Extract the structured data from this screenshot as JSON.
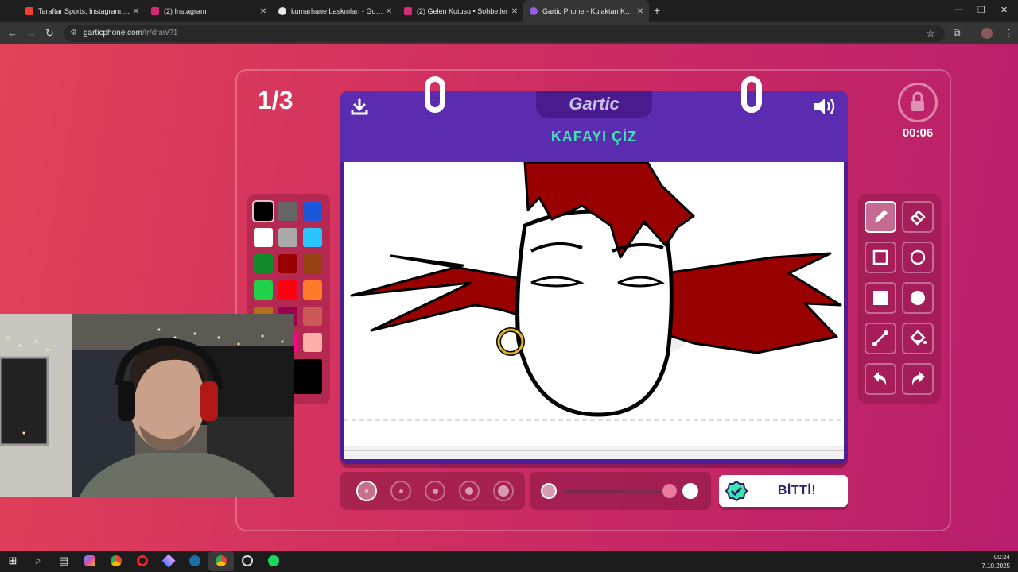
{
  "browser": {
    "tabs": [
      {
        "title": "Taraftar Sports, Instagram: \"\"Bu",
        "favicon": "gmail-icon",
        "color": "#ea4335"
      },
      {
        "title": "(2) Instagram",
        "favicon": "instagram-icon",
        "color": "#d62976"
      },
      {
        "title": "kumarhane baskınları - Google",
        "favicon": "google-icon",
        "color": "#4285f4"
      },
      {
        "title": "(2) Gelen Kutusu • Sohbetler",
        "favicon": "instagram-icon",
        "color": "#d62976"
      },
      {
        "title": "Gartic Phone - Kulaktan Kulağa",
        "favicon": "gartic-icon",
        "color": "#9b5de5"
      }
    ],
    "url_host": "garticphone.com",
    "url_path": "/tr/draw?1"
  },
  "game": {
    "round": "1/3",
    "timer": "00:06",
    "logo": "Gartic",
    "prompt": "KAFAYI ÇİZ",
    "done_label": "BİTTİ!",
    "palette": [
      "#000000",
      "#666666",
      "#1a56d8",
      "#ffffff",
      "#aaaaaa",
      "#29c5ff",
      "#118b2a",
      "#990000",
      "#964112",
      "#22d24a",
      "#ff0013",
      "#ff7b29",
      "#b0701c",
      "#99004e",
      "#cb5a57",
      "#ff5c9e",
      "#ff008f",
      "#feafa8"
    ],
    "selected_color": "#000000",
    "tools": [
      "pencil-icon",
      "eraser-icon",
      "rectangle-outline-icon",
      "ellipse-outline-icon",
      "rectangle-fill-icon",
      "ellipse-fill-icon",
      "line-icon",
      "fill-bucket-icon",
      "undo-icon",
      "redo-icon"
    ],
    "selected_tool": "pencil-icon",
    "brush_sizes_count": 5,
    "selected_brush_size": 1,
    "opacity": 1
  },
  "taskbar": {
    "time": "00:24",
    "date": "7.10.2025"
  }
}
